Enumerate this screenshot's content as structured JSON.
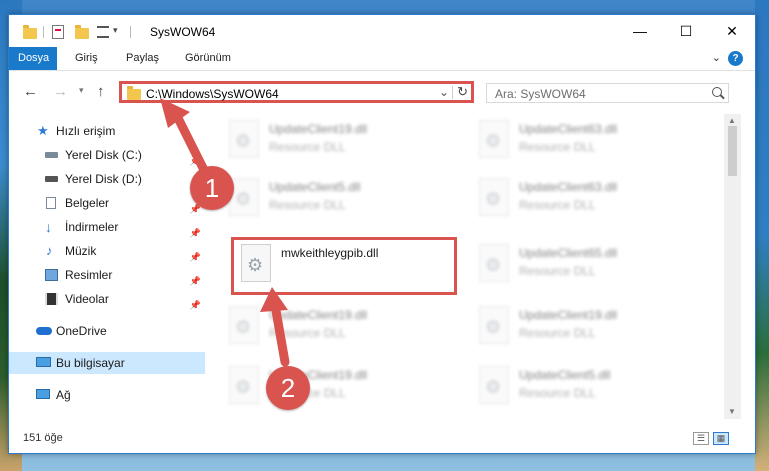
{
  "window": {
    "title": "SysWOW64"
  },
  "ribbon": {
    "tabs": [
      "Dosya",
      "Giriş",
      "Paylaş",
      "Görünüm"
    ],
    "help": "?"
  },
  "nav": {
    "back": "←",
    "forward": "→",
    "up": "↑",
    "refresh": "↻",
    "dropdown": "⌄"
  },
  "address": {
    "path": "C:\\Windows\\SysWOW64"
  },
  "search": {
    "placeholder": "Ara: SysWOW64"
  },
  "sidebar": {
    "items": [
      {
        "label": "Hızlı erişim",
        "icon": "star-icon"
      },
      {
        "label": "Yerel Disk (C:)",
        "icon": "drive-icon",
        "pinned": true
      },
      {
        "label": "Yerel Disk (D:)",
        "icon": "drive-icon",
        "pinned": true
      },
      {
        "label": "Belgeler",
        "icon": "documents-icon",
        "pinned": true
      },
      {
        "label": "İndirmeler",
        "icon": "download-icon",
        "pinned": true
      },
      {
        "label": "Müzik",
        "icon": "music-icon",
        "pinned": true
      },
      {
        "label": "Resimler",
        "icon": "pictures-icon",
        "pinned": true
      },
      {
        "label": "Videolar",
        "icon": "videos-icon",
        "pinned": true
      },
      {
        "label": "OneDrive",
        "icon": "cloud-icon"
      },
      {
        "label": "Bu bilgisayar",
        "icon": "computer-icon",
        "selected": true
      },
      {
        "label": "Ağ",
        "icon": "network-icon"
      }
    ]
  },
  "files": [
    {
      "name": "UpdateClient19.dll",
      "type": "Resource DLL"
    },
    {
      "name": "UpdateClient63.dll",
      "type": "Resource DLL"
    },
    {
      "name": "UpdateClient5.dll",
      "type": "Resource DLL"
    },
    {
      "name": "UpdateClient63.dll",
      "type": "Resource DLL"
    },
    {
      "name": "mwkeithleygpib.dll",
      "type": ""
    },
    {
      "name": "UpdateClient65.dll",
      "type": "Resource DLL"
    },
    {
      "name": "UpdateClient19.dll",
      "type": "Resource DLL"
    },
    {
      "name": "UpdateClient19.dll",
      "type": "Resource DLL"
    },
    {
      "name": "UpdateClient19.dll",
      "type": "Resource DLL"
    },
    {
      "name": "UpdateClient5.dll",
      "type": "Resource DLL"
    }
  ],
  "status": {
    "count": "151 öğe"
  },
  "annotations": {
    "step1": "1",
    "step2": "2"
  },
  "colors": {
    "accent": "#1979ca",
    "highlight": "#d9534f",
    "selected": "#cce8ff"
  }
}
